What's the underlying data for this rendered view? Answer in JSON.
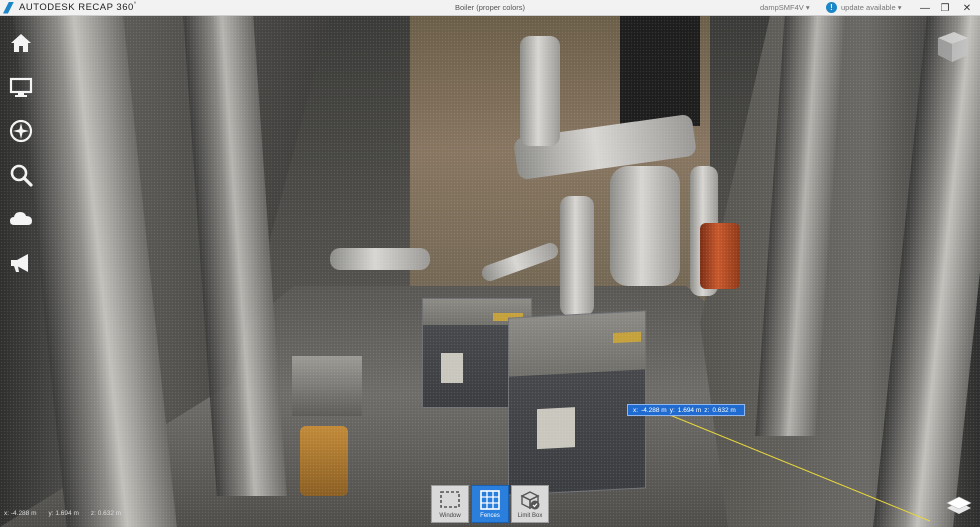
{
  "app": {
    "brand": "AUTODESK",
    "product": "RECAP 360",
    "registered": "°",
    "document_title": "Boiler (proper colors)",
    "user_name": "dampSMF4V ▾",
    "update_label": "update available ▾",
    "update_icon": "!"
  },
  "window_controls": [
    {
      "name": "minimize-button",
      "glyph": "—"
    },
    {
      "name": "restore-button",
      "glyph": "❐"
    },
    {
      "name": "close-button",
      "glyph": "✕"
    }
  ],
  "left_nav": [
    {
      "name": "home-icon"
    },
    {
      "name": "monitor-icon"
    },
    {
      "name": "compass-icon"
    },
    {
      "name": "search-icon"
    },
    {
      "name": "cloud-icon"
    },
    {
      "name": "megaphone-icon"
    }
  ],
  "measurement": {
    "x_label": "x:",
    "x": "-4.288 m",
    "y_label": "y:",
    "y": "1.694 m",
    "z_label": "z:",
    "z": "0.632 m"
  },
  "coordinates": {
    "x": "x: -4.288 m",
    "y": "y: 1.694 m",
    "z": "z: 0.632 m"
  },
  "selection_tools": [
    {
      "name": "window-select-button",
      "label": "Window",
      "icon": "dashed-rectangle-icon",
      "active": false
    },
    {
      "name": "fences-select-button",
      "label": "Fences",
      "icon": "grid-icon",
      "active": true
    },
    {
      "name": "limit-box-button",
      "label": "Limit Box",
      "icon": "box-check-icon",
      "active": false
    }
  ],
  "colors": {
    "accent": "#1d86c7",
    "active_tool": "#2a7fdc",
    "measure_line": "#e6d63a"
  }
}
